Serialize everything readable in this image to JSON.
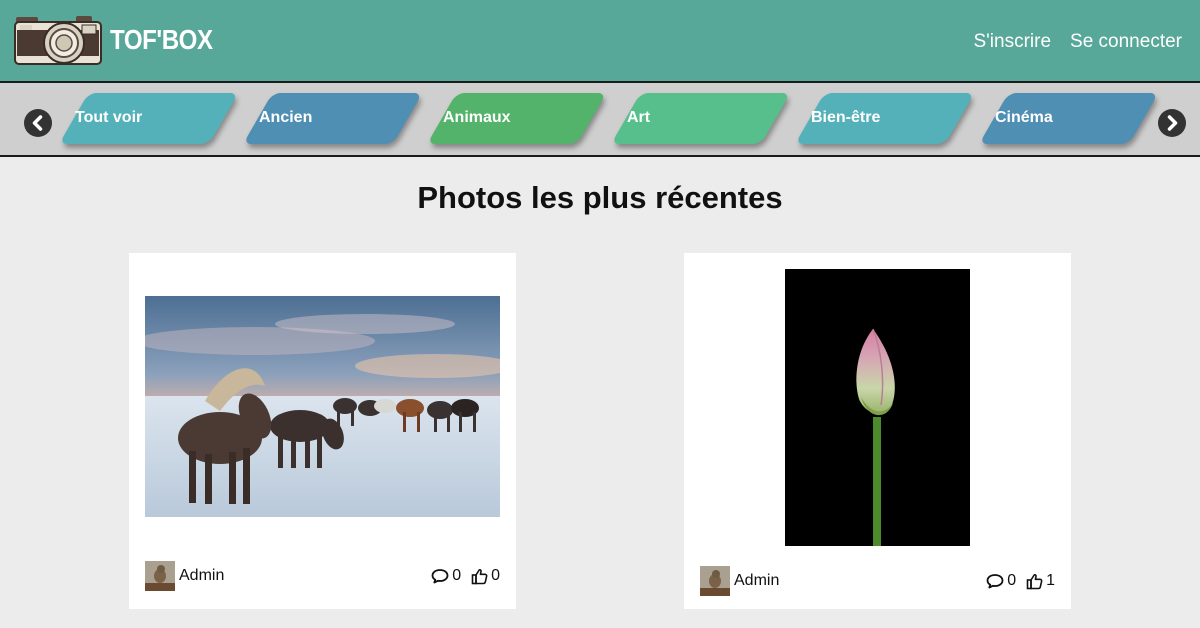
{
  "header": {
    "brand": "TOF'BOX",
    "signup_label": "S'inscrire",
    "login_label": "Se connecter"
  },
  "categories": [
    {
      "label": "Tout voir",
      "color": "#54b1ba"
    },
    {
      "label": "Ancien",
      "color": "#4e8fb3"
    },
    {
      "label": "Animaux",
      "color": "#53b36a"
    },
    {
      "label": "Art",
      "color": "#57bf8c"
    },
    {
      "label": "Bien-être",
      "color": "#54b1ba"
    },
    {
      "label": "Cinéma",
      "color": "#4e8fb3"
    }
  ],
  "main": {
    "title": "Photos les plus récentes"
  },
  "photos": [
    {
      "author": "Admin",
      "comments": "0",
      "likes": "0",
      "subject": "horses-in-snow"
    },
    {
      "author": "Admin",
      "comments": "0",
      "likes": "1",
      "subject": "lotus-bud"
    }
  ],
  "colors": {
    "header_bg": "#57a899",
    "bar_bg": "#cfcfcf",
    "page_bg": "#ececec"
  }
}
